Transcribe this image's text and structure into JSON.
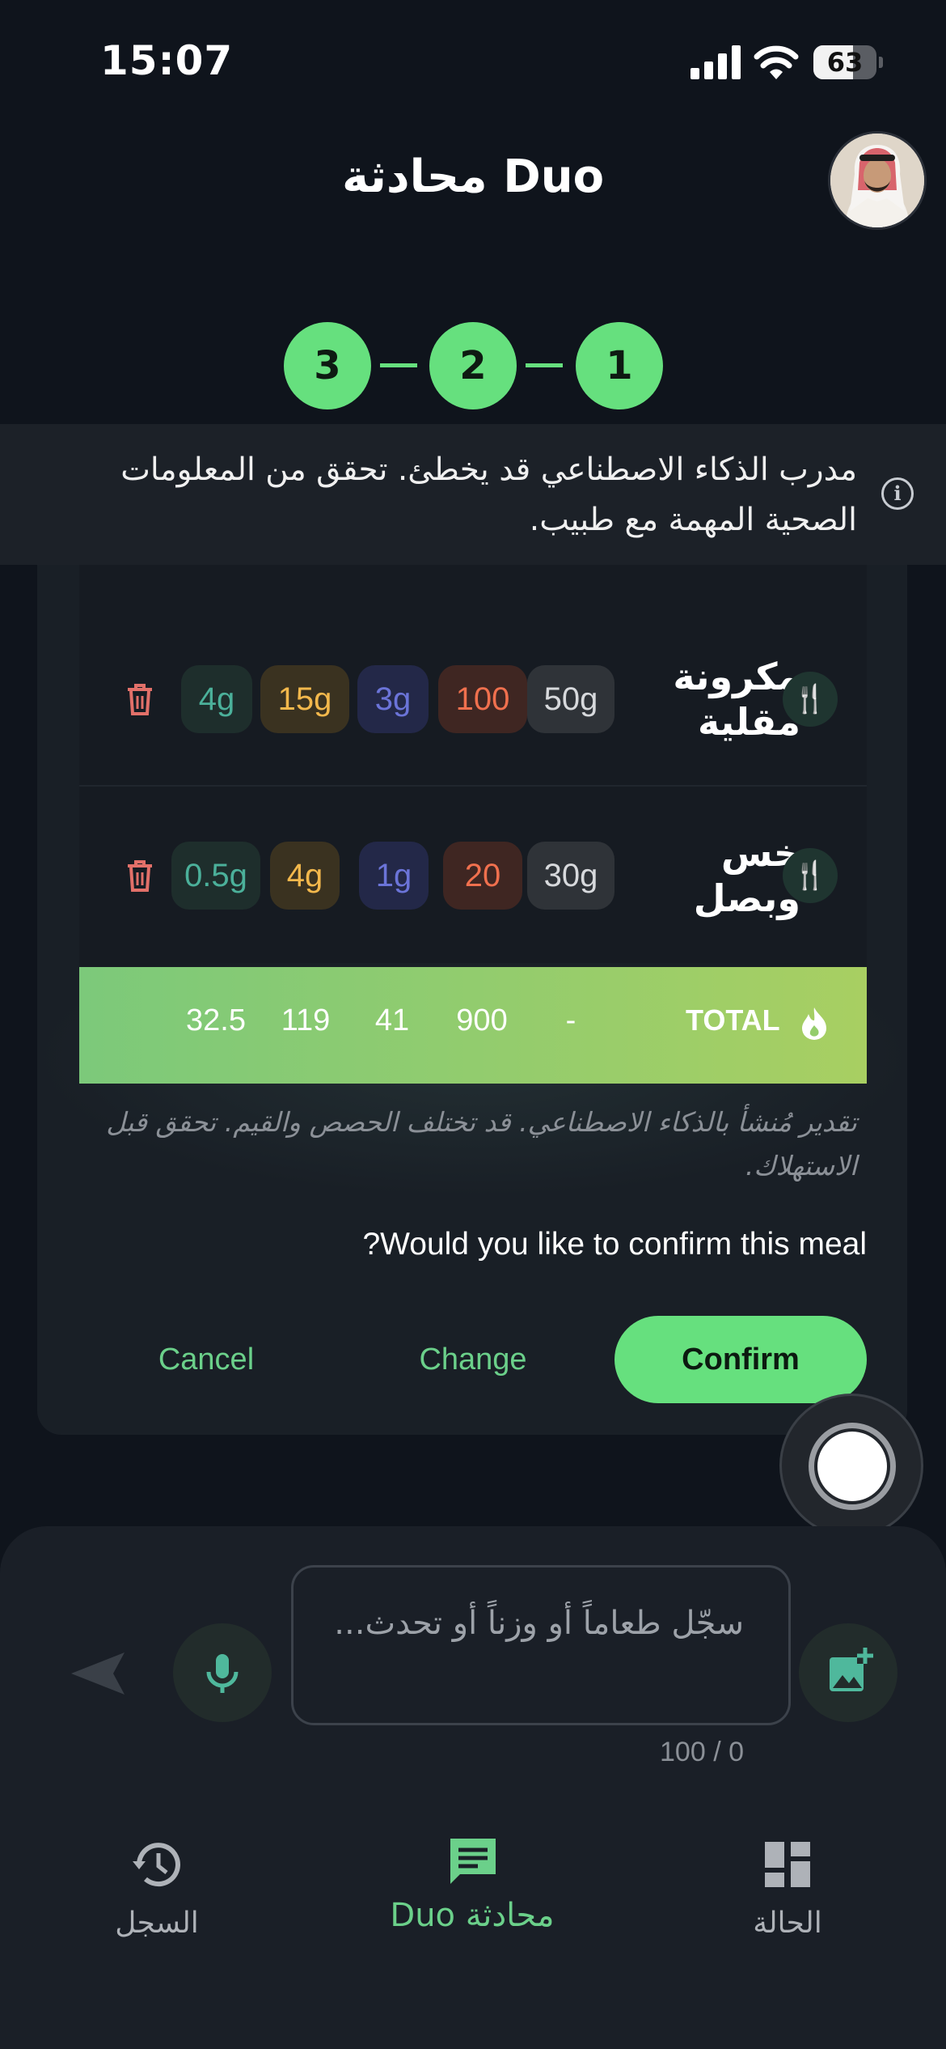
{
  "status_bar": {
    "time": "15:07",
    "battery": "63",
    "battery_level": 0.63
  },
  "header": {
    "title": "محادثة Duo",
    "avatar_icon": "user-avatar"
  },
  "steps": [
    "1",
    "2",
    "3"
  ],
  "warning": {
    "text": "مدرب الذكاء الاصطناعي قد يخطئ. تحقق من المعلومات الصحية المهمة مع طبيب.",
    "icon": "info-icon"
  },
  "meal": {
    "items": [
      {
        "name": "مكرونة مقلية",
        "weight": "50g",
        "calories": "100",
        "protein": "3g",
        "carbs": "15g",
        "fat": "4g"
      },
      {
        "name": "خس وبصل",
        "weight": "30g",
        "calories": "20",
        "protein": "1g",
        "carbs": "4g",
        "fat": "0.5g"
      }
    ],
    "total": {
      "label": "TOTAL",
      "weight": "-",
      "calories": "900",
      "protein": "41",
      "carbs": "119",
      "fat": "32.5"
    },
    "disclaimer": "تقدير مُنشأ بالذكاء الاصطناعي. قد تختلف الحصص والقيم. تحقق قبل الاستهلاك.",
    "question": "?Would you like to confirm this meal",
    "actions": {
      "cancel": "Cancel",
      "change": "Change",
      "confirm": "Confirm"
    }
  },
  "composer": {
    "placeholder": "سجّل طعاماً أو وزناً أو تحدث...",
    "counter": "100 / 0"
  },
  "nav": {
    "history": "السجل",
    "chat": "محادثة Duo",
    "status": "الحالة"
  },
  "colors": {
    "accent": "#66e07e",
    "background": "#0f141c",
    "total_bar_start": "#7cc97a",
    "total_bar_end": "#a8cf62"
  }
}
